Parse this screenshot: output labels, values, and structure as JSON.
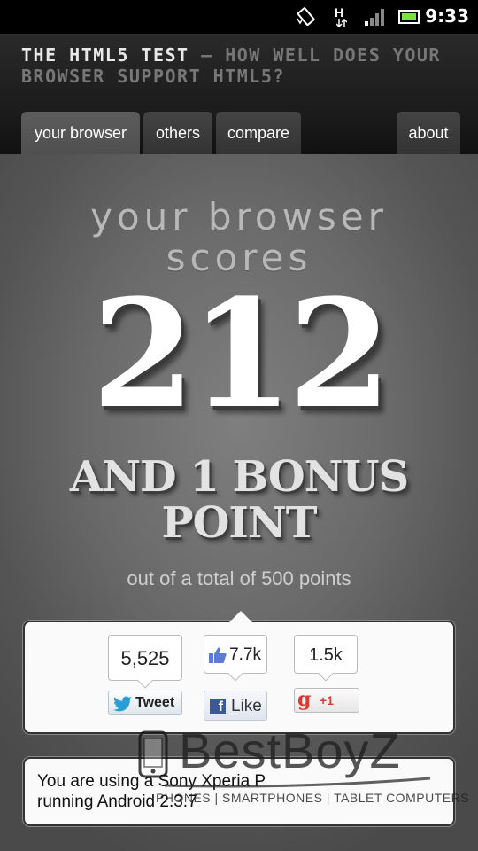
{
  "status_bar": {
    "time": "9:33",
    "network_label": "H",
    "icons": [
      "screen-rotation-icon",
      "network-h-icon",
      "signal-icon",
      "battery-icon"
    ]
  },
  "header": {
    "title_strong": "THE HTML5 TEST",
    "title_rest": " – HOW WELL DOES YOUR BROWSER SUPPORT HTML5?",
    "tabs": [
      {
        "label": "your browser",
        "active": true
      },
      {
        "label": "others",
        "active": false
      },
      {
        "label": "compare",
        "active": false
      },
      {
        "label": "about",
        "active": false
      }
    ]
  },
  "score": {
    "heading_line1": "your browser",
    "heading_line2": "scores",
    "value": "212",
    "bonus_line1": "AND 1 BONUS",
    "bonus_line2": "POINT",
    "total_text": "out of a total of 500 points"
  },
  "share": {
    "twitter": {
      "count": "5,525",
      "label": "Tweet"
    },
    "facebook": {
      "count": "7.7k",
      "label": "Like"
    },
    "google": {
      "count": "1.5k",
      "label": "+1"
    }
  },
  "info": {
    "line1": "You are using a Sony Xperia P",
    "line2": "running Android 2.3.7"
  },
  "watermark": {
    "brand": "BestBoyZ",
    "tagline": "PHONES | SMARTPHONES | TABLET COMPUTERS"
  },
  "colors": {
    "header_bg": "#1f1f1f",
    "tab_active": "#555555",
    "tab_inactive": "#3a3a3a",
    "twitter_blue": "#2a9fd6",
    "facebook_blue": "#3b5998",
    "google_red": "#d73d32"
  }
}
